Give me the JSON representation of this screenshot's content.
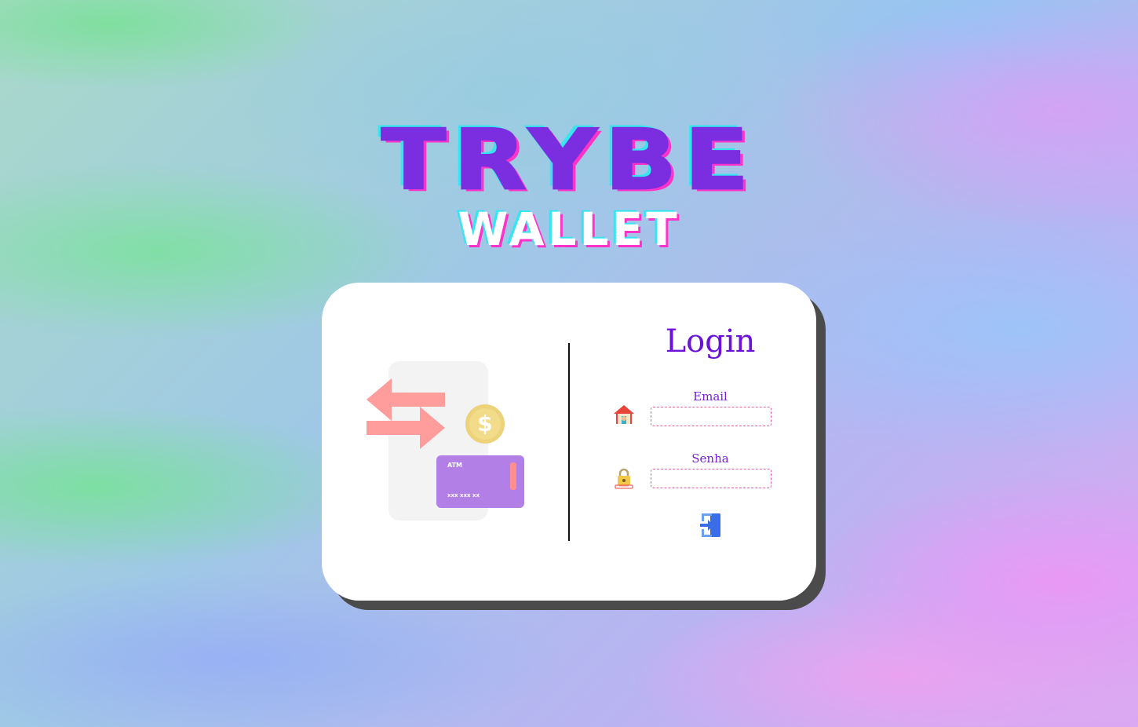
{
  "logo": {
    "title": "TRYBE",
    "subtitle": "WALLET"
  },
  "illustration": {
    "coin_symbol": "$",
    "card_label": "ATM",
    "card_number": "xxx xxx xx"
  },
  "login": {
    "title": "Login",
    "email_label": "Email",
    "email_value": "",
    "password_label": "Senha",
    "password_value": "",
    "submit_icon": "login-door-icon"
  },
  "colors": {
    "title_purple": "#7a2ee0",
    "cyan_shadow": "#35e6f0",
    "pink_shadow": "#ff33c8",
    "label_purple": "#7a1fd6",
    "input_border": "#e35ba8",
    "submit_blue": "#3a6ee8"
  }
}
